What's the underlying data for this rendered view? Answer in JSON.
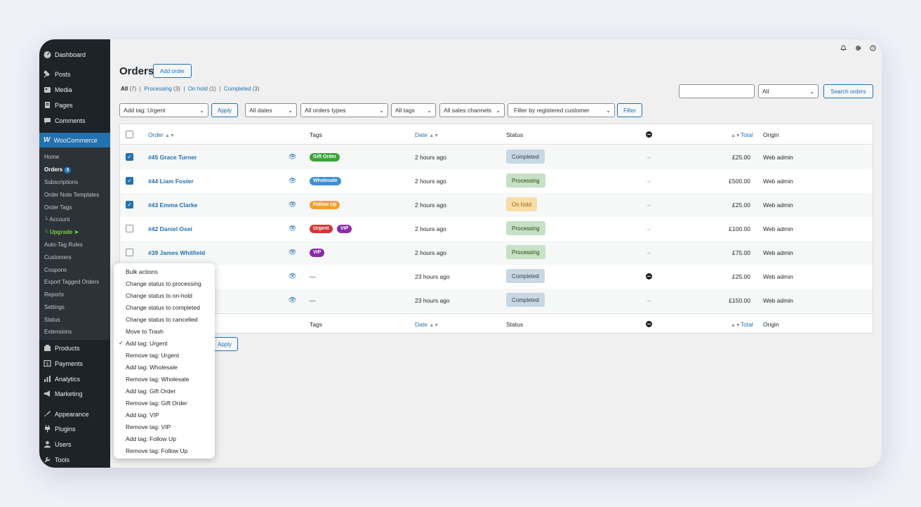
{
  "sidebar": {
    "top": [
      {
        "label": "Dashboard",
        "icon": "dashboard-icon"
      },
      {
        "label": "Posts",
        "icon": "pin-icon"
      },
      {
        "label": "Media",
        "icon": "media-icon"
      },
      {
        "label": "Pages",
        "icon": "pages-icon"
      },
      {
        "label": "Comments",
        "icon": "comment-icon"
      }
    ],
    "woocommerce": "WooCommerce",
    "woo_logo": "W",
    "submenu": [
      {
        "label": "Home"
      },
      {
        "label": "Orders",
        "badge": "3"
      },
      {
        "label": "Subscriptions"
      },
      {
        "label": "Order Note Templates"
      },
      {
        "label": "Order Tags"
      },
      {
        "label": "└ Account"
      },
      {
        "label": "└ Upgrade ➤"
      },
      {
        "label": "Auto-Tag Rules"
      },
      {
        "label": "Customers"
      },
      {
        "label": "Coupons"
      },
      {
        "label": "Export Tagged Orders"
      },
      {
        "label": "Reports"
      },
      {
        "label": "Settings"
      },
      {
        "label": "Status"
      },
      {
        "label": "Extensions"
      }
    ],
    "bottom": [
      {
        "label": "Products",
        "icon": "products-icon"
      },
      {
        "label": "Payments",
        "icon": "payments-icon"
      },
      {
        "label": "Analytics",
        "icon": "analytics-icon"
      },
      {
        "label": "Marketing",
        "icon": "megaphone-icon"
      },
      {
        "label": "Appearance",
        "icon": "brush-icon"
      },
      {
        "label": "Plugins",
        "icon": "plug-icon"
      },
      {
        "label": "Users",
        "icon": "user-icon"
      },
      {
        "label": "Tools",
        "icon": "wrench-icon"
      }
    ]
  },
  "topbar": {
    "icons": [
      "bell-icon",
      "gear-icon",
      "help-icon"
    ]
  },
  "page": {
    "title": "Orders",
    "add_order": "Add order",
    "filters": {
      "all": "All",
      "all_count": "(7)",
      "processing": "Processing",
      "processing_count": "(3)",
      "on_hold": "On hold",
      "on_hold_count": "(1)",
      "completed": "Completed",
      "completed_count": "(3)",
      "sep": "|"
    },
    "search_scope": "All",
    "search_button": "Search orders",
    "bulk_action": "Add tag: Urgent",
    "apply": "Apply",
    "dates": "All dates",
    "order_types": "All orders types",
    "tags": "All tags",
    "channels": "All sales channels",
    "customer": "Filter by registered customer",
    "filter": "Filter"
  },
  "table": {
    "headers": {
      "order": "Order",
      "tags": "Tags",
      "date": "Date",
      "status": "Status",
      "total": "Total",
      "origin": "Origin",
      "sort": "▲▼"
    },
    "rows": [
      {
        "order": "#45 Grace Turner",
        "checked": true,
        "tags": [
          {
            "label": "Gift Order",
            "color": "#3aa33a"
          }
        ],
        "date": "2 hours ago",
        "status": "Completed",
        "status_class": "st-completed",
        "note": "–",
        "total": "£25.00",
        "origin": "Web admin"
      },
      {
        "order": "#44 Liam Foster",
        "checked": true,
        "tags": [
          {
            "label": "Wholesale",
            "color": "#3b8fd6"
          }
        ],
        "date": "2 hours ago",
        "status": "Processing",
        "status_class": "st-processing",
        "note": "–",
        "total": "£500.00",
        "origin": "Web admin"
      },
      {
        "order": "#43 Emma Clarke",
        "checked": true,
        "tags": [
          {
            "label": "Follow Up",
            "color": "#f0a030"
          }
        ],
        "date": "2 hours ago",
        "status": "On hold",
        "status_class": "st-hold",
        "note": "–",
        "total": "£25.00",
        "origin": "Web admin"
      },
      {
        "order": "#42 Daniel Osei",
        "checked": false,
        "tags": [
          {
            "label": "Urgent",
            "color": "#d63638"
          },
          {
            "label": "VIP",
            "color": "#8a2aa8"
          }
        ],
        "date": "2 hours ago",
        "status": "Processing",
        "status_class": "st-processing",
        "note": "–",
        "total": "£100.00",
        "origin": "Web admin"
      },
      {
        "order": "#39 James Whitfield",
        "checked": false,
        "tags": [
          {
            "label": "VIP",
            "color": "#8a2aa8"
          }
        ],
        "date": "2 hours ago",
        "status": "Processing",
        "status_class": "st-processing",
        "note": "–",
        "total": "£75.00",
        "origin": "Web admin"
      },
      {
        "order": "",
        "checked": false,
        "tags": [],
        "tag_dash": "—",
        "date": "23 hours ago",
        "status": "Completed",
        "status_class": "st-completed",
        "note_icon": true,
        "total": "£25.00",
        "origin": "Web admin"
      },
      {
        "order": "",
        "checked": false,
        "tags": [],
        "tag_dash": "—",
        "date": "23 hours ago",
        "status": "Completed",
        "status_class": "st-completed",
        "note": "–",
        "total": "£150.00",
        "origin": "Web admin"
      }
    ]
  },
  "bulk_menu": {
    "check": "✓",
    "selected": "Add tag: Urgent",
    "items": [
      "Bulk actions",
      "Change status to processing",
      "Change status to on-hold",
      "Change status to completed",
      "Change status to cancelled",
      "Move to Trash",
      "Add tag: Urgent",
      "Remove tag: Urgent",
      "Add tag: Wholesale",
      "Remove tag: Wholesale",
      "Add tag: Gift Order",
      "Remove tag: Gift Order",
      "Add tag: VIP",
      "Remove tag: VIP",
      "Add tag: Follow Up",
      "Remove tag: Follow Up"
    ]
  }
}
